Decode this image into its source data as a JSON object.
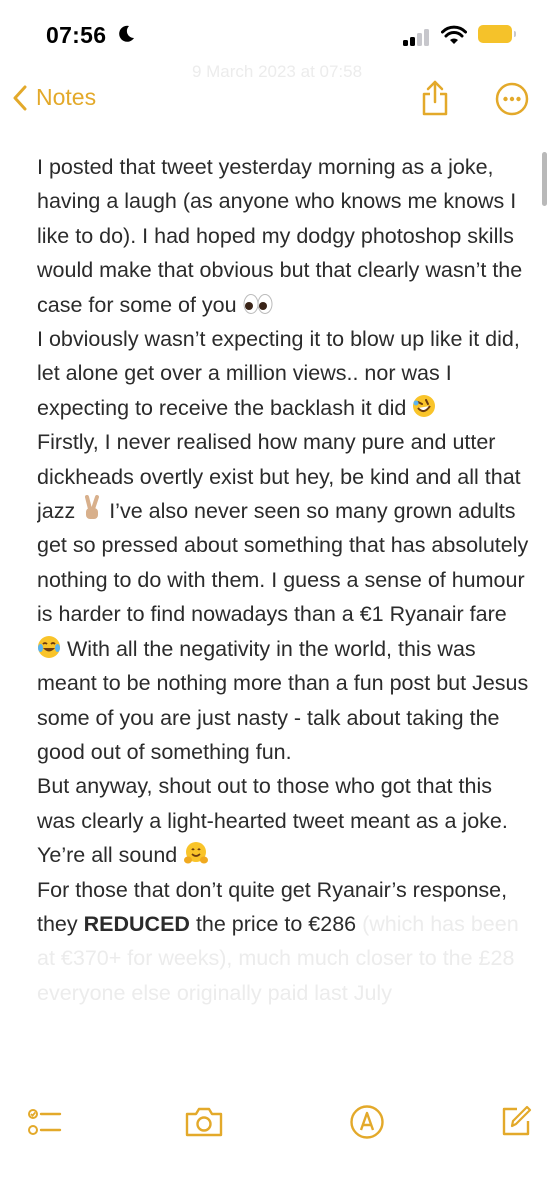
{
  "status_bar": {
    "time": "07:56"
  },
  "nav": {
    "back_label": "Notes",
    "date_ghost": "9 March 2023 at 07:58"
  },
  "note": {
    "p1": "I posted that tweet yesterday morning as a joke, having a laugh (as anyone who knows me knows I like to do). I had hoped my dodgy photoshop skills would make that obvious but that clearly wasn’t the case for some of you",
    "p2": "I obviously wasn’t expecting it to blow up like it did, let alone get over a million views.. nor was I expecting to receive the backlash it did",
    "p3a": "Firstly, I never realised how many pure and utter dickheads overtly exist but hey, be kind and all that jazz",
    "p3b": "I’ve also never seen so many grown adults get so pressed about something that has absolutely nothing to do with them. I guess a sense of humour is harder to find nowadays than a €1 Ryanair fare",
    "p3c": "With all the negativity in the world, this was meant to be nothing more than a fun post but Jesus some of you are just nasty - talk about taking the good out of something fun.",
    "p4": "But anyway, shout out to those who got that this was clearly a light-hearted tweet meant as a joke. Ye’re all sound",
    "p5a": "For those that don’t quite get Ryanair’s response, they",
    "p5b": "REDUCED",
    "p5c": "the price to €286",
    "p5d": "(which has been at €370+ for weeks), much much closer to the £2",
    "p5e": "everyone else originally paid last July"
  },
  "colors": {
    "accent": "#e3a92a",
    "battery": "#f5c22a"
  },
  "icons": [
    "moon-icon",
    "signal-icon",
    "wifi-icon",
    "battery-icon",
    "chevron-left-icon",
    "share-icon",
    "more-icon",
    "checklist-icon",
    "camera-icon",
    "markup-icon",
    "compose-icon"
  ]
}
